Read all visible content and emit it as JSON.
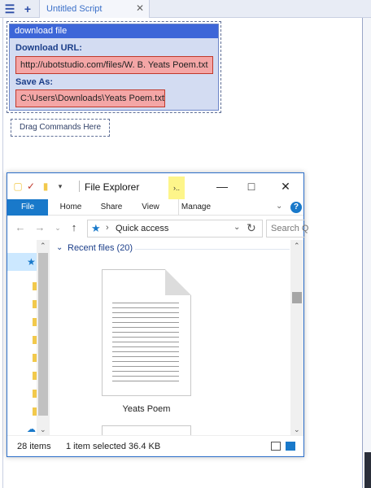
{
  "ubot": {
    "tab_title": "Untitled Script",
    "menu_icon": "☰",
    "add_icon": "+",
    "close_icon": "✕",
    "command": {
      "title": "download file",
      "url_label": "Download URL:",
      "url_value": "http://ubotstudio.com/files/W. B. Yeats Poem.txt",
      "saveas_label": "Save As:",
      "saveas_value": "C:\\Users\\Downloads\\Yeats Poem.txt"
    },
    "drag_label": "Drag Commands Here"
  },
  "explorer": {
    "title": "File Explorer",
    "tooltip": "›..",
    "window_buttons": {
      "minimize": "—",
      "maximize": "□",
      "close": "✕"
    },
    "ribbon_tabs": [
      "File",
      "Home",
      "Share",
      "View",
      "Manage"
    ],
    "help": "?",
    "address": "Quick access",
    "search_placeholder": "Search Q",
    "group_label": "Recent files (20)",
    "file_name": "Yeats Poem",
    "status": {
      "items": "28 items",
      "selected": "1 item selected  36.4 KB"
    }
  },
  "colors": {
    "command_header": "#3d66d8",
    "command_body": "#d3dcf2",
    "value_fill": "#f4a6a6",
    "value_border": "#c0392b",
    "explorer_accent": "#1979ca",
    "selection": "#cce8ff"
  }
}
